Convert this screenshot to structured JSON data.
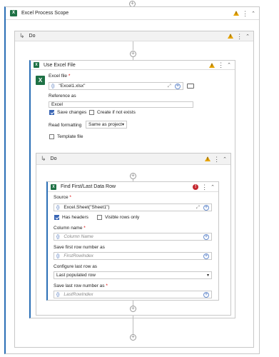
{
  "scope": {
    "title": "Excel Process Scope"
  },
  "do_outer": {
    "title": "Do"
  },
  "use_excel": {
    "title": "Use Excel File",
    "excel_file_label": "Excel file",
    "excel_file_value": "\"Excel1.xlsx\"",
    "reference_label": "Reference as",
    "reference_value": "Excel",
    "save_changes": "Save changes",
    "create_if_not_exists": "Create if not exists",
    "read_formatting_label": "Read formatting",
    "read_formatting_value": "Same as project",
    "template_file": "Template file"
  },
  "do_inner": {
    "title": "Do"
  },
  "find_row": {
    "title": "Find First/Last Data Row",
    "source_label": "Source",
    "source_value": "Excel.Sheet(\"Sheet1\")",
    "has_headers": "Has headers",
    "visible_rows_only": "Visible rows only",
    "column_name_label": "Column name",
    "column_name_placeholder": "Column Name",
    "save_first_label": "Save first row number as",
    "save_first_placeholder": "FirstRowIndex",
    "configure_last_label": "Configure last row as",
    "configure_last_value": "Last populated row",
    "save_last_label": "Save last row number as",
    "save_last_placeholder": "LastRowIndex"
  },
  "symbols": {
    "curly": "{}",
    "required": "*",
    "plus": "+",
    "dots": "⋮",
    "chevrons": "⌃",
    "do_arrow": "↳",
    "xls": "X",
    "error": "!"
  }
}
